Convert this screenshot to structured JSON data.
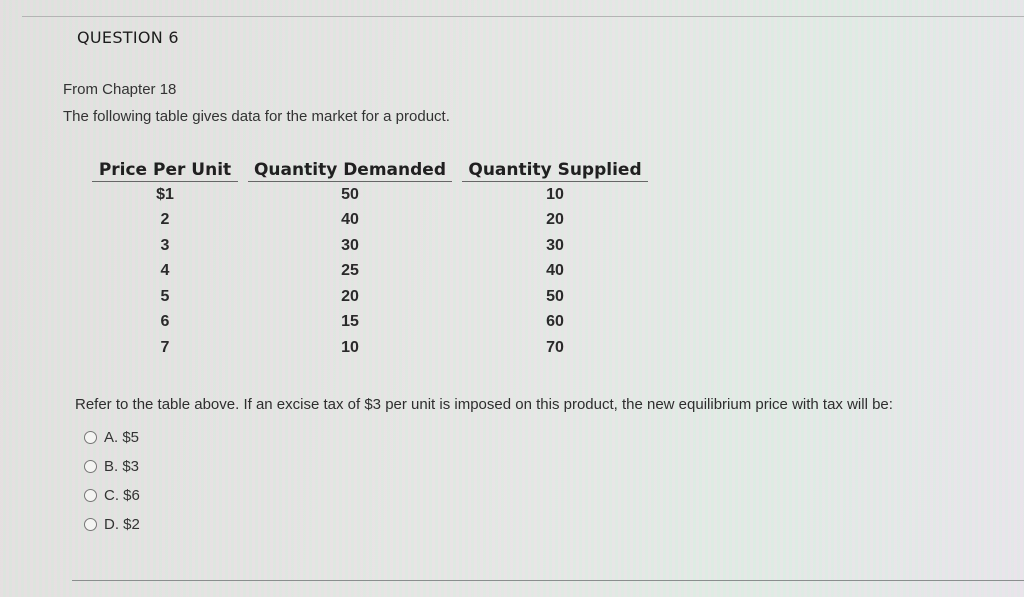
{
  "question": {
    "title": "QUESTION 6",
    "source": "From Chapter 18",
    "intro": "The following table gives data for the market for a product.",
    "table": {
      "headers": [
        "Price Per Unit",
        "Quantity Demanded",
        "Quantity Supplied"
      ],
      "rows": [
        {
          "price": "$1",
          "demanded": "50",
          "supplied": "10"
        },
        {
          "price": "2",
          "demanded": "40",
          "supplied": "20"
        },
        {
          "price": "3",
          "demanded": "30",
          "supplied": "30"
        },
        {
          "price": "4",
          "demanded": "25",
          "supplied": "40"
        },
        {
          "price": "5",
          "demanded": "20",
          "supplied": "50"
        },
        {
          "price": "6",
          "demanded": "15",
          "supplied": "60"
        },
        {
          "price": "7",
          "demanded": "10",
          "supplied": "70"
        }
      ]
    },
    "prompt": "Refer to the table above. If an excise tax of $3 per unit is imposed on this product, the new equilibrium price with tax will be:",
    "options": [
      {
        "label": "A. $5",
        "selected": false
      },
      {
        "label": "B. $3",
        "selected": false
      },
      {
        "label": "C. $6",
        "selected": false
      },
      {
        "label": "D. $2",
        "selected": false
      }
    ]
  }
}
